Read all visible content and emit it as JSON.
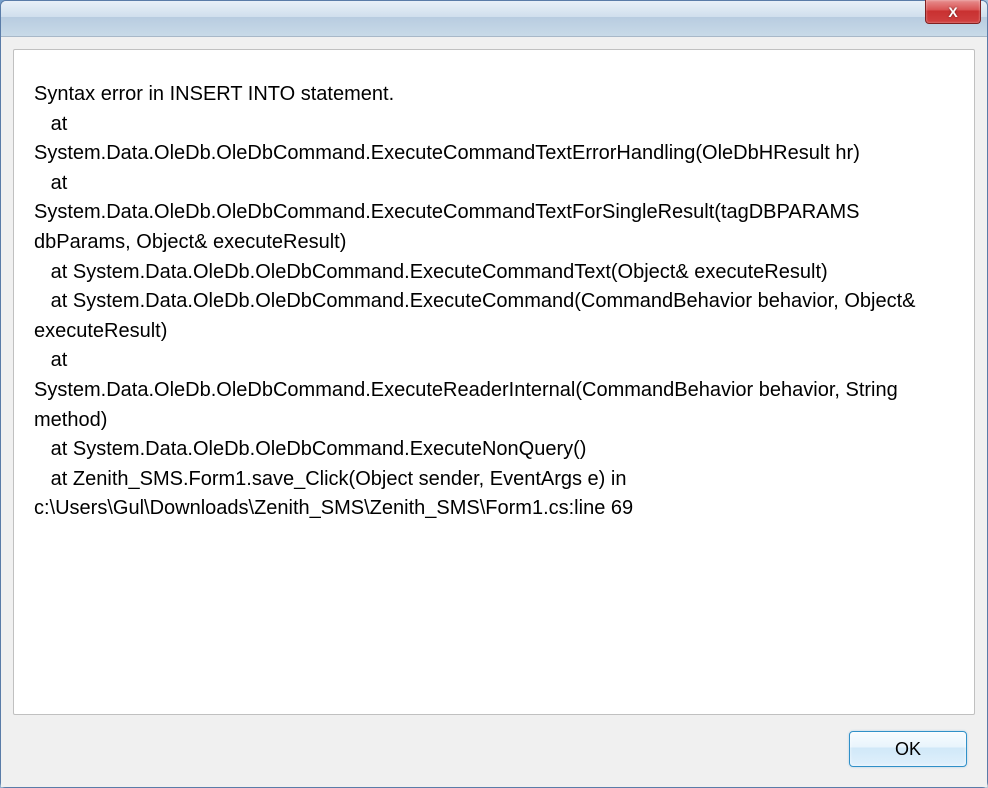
{
  "dialog": {
    "close_x": "X",
    "error_message": "Syntax error in INSERT INTO statement.\n   at\nSystem.Data.OleDb.OleDbCommand.ExecuteCommandTextErrorHandling(OleDbHResult hr)\n   at\nSystem.Data.OleDb.OleDbCommand.ExecuteCommandTextForSingleResult(tagDBPARAMS dbParams, Object& executeResult)\n   at System.Data.OleDb.OleDbCommand.ExecuteCommandText(Object& executeResult)\n   at System.Data.OleDb.OleDbCommand.ExecuteCommand(CommandBehavior behavior, Object& executeResult)\n   at\nSystem.Data.OleDb.OleDbCommand.ExecuteReaderInternal(CommandBehavior behavior, String method)\n   at System.Data.OleDb.OleDbCommand.ExecuteNonQuery()\n   at Zenith_SMS.Form1.save_Click(Object sender, EventArgs e) in c:\\Users\\Gul\\Downloads\\Zenith_SMS\\Zenith_SMS\\Form1.cs:line 69",
    "ok_label": "OK"
  }
}
